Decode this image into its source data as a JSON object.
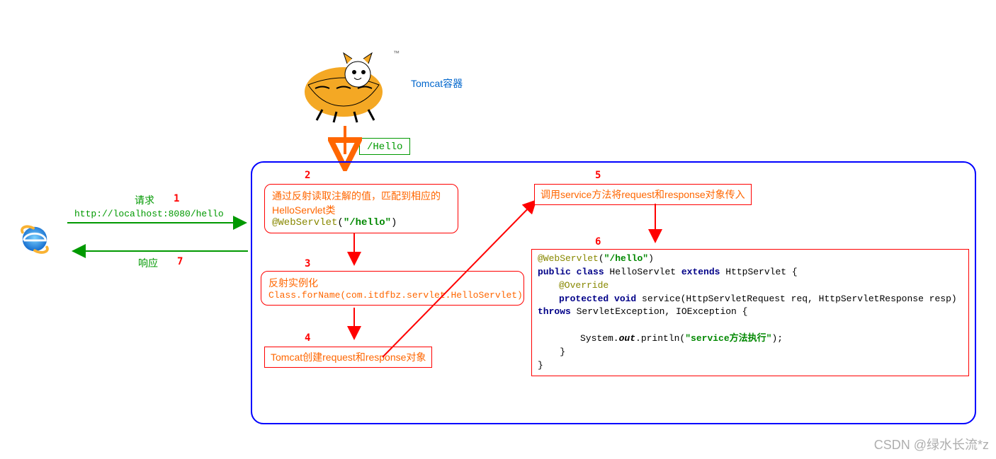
{
  "tomcat_label": "Tomcat容器",
  "hello_path": "/Hello",
  "request_label": "请求",
  "request_url": "http://localhost:8080/hello",
  "response_label": "响应",
  "step_numbers": {
    "n1": "1",
    "n2": "2",
    "n3": "3",
    "n4": "4",
    "n5": "5",
    "n6": "6",
    "n7": "7"
  },
  "box2_text": "通过反射读取注解的值，匹配到相应的HelloServlet类",
  "box2_anno": "@WebServlet",
  "box2_anno_path": "\"/hello\"",
  "box3_title": "反射实例化",
  "box3_code": "Class.forName(com.itdfbz.servlet.HelloServlet)",
  "box4_text": "Tomcat创建request和response对象",
  "box5_text": "调用service方法将request和response对象传入",
  "box6_anno": "@WebServlet",
  "box6_anno_path": "\"/hello\"",
  "box6_line2_a": "public class",
  "box6_line2_b": " HelloServlet ",
  "box6_line2_c": "extends",
  "box6_line2_d": " HttpServlet {",
  "box6_override": "@Override",
  "box6_line4_a": "protected void",
  "box6_line4_b": " service(HttpServletRequest req, HttpServletResponse resp)",
  "box6_line5_a": "throws",
  "box6_line5_b": " ServletException, IOException {",
  "box6_line6_a": "System.",
  "box6_line6_out": "out",
  "box6_line6_b": ".println(",
  "box6_line6_str": "\"service方法执行\"",
  "box6_line6_c": ");",
  "box6_line7": "    }",
  "box6_line8": "}",
  "watermark": "CSDN @绿水长流*z"
}
